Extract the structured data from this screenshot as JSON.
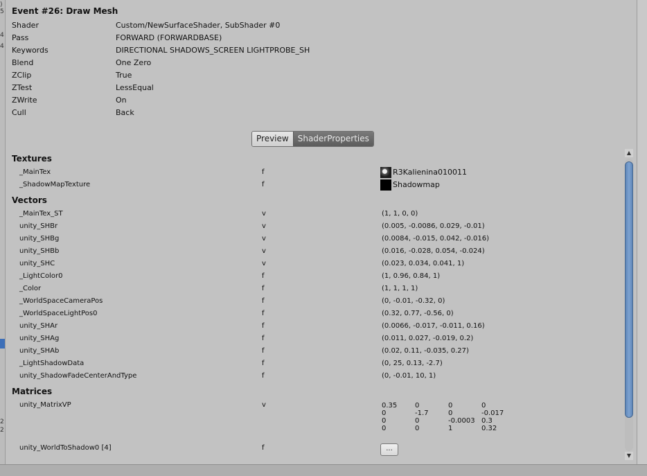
{
  "event": {
    "title": "Event #26: Draw Mesh",
    "properties": [
      {
        "key": "Shader",
        "value": "Custom/NewSurfaceShader, SubShader #0"
      },
      {
        "key": "Pass",
        "value": "FORWARD (FORWARDBASE)"
      },
      {
        "key": "Keywords",
        "value": "DIRECTIONAL SHADOWS_SCREEN LIGHTPROBE_SH"
      },
      {
        "key": "Blend",
        "value": "One Zero"
      },
      {
        "key": "ZClip",
        "value": "True"
      },
      {
        "key": "ZTest",
        "value": "LessEqual"
      },
      {
        "key": "ZWrite",
        "value": "On"
      },
      {
        "key": "Cull",
        "value": "Back"
      }
    ]
  },
  "tabs": [
    {
      "label": "Preview",
      "active": false
    },
    {
      "label": "ShaderProperties",
      "active": true
    }
  ],
  "textures": {
    "heading": "Textures",
    "items": [
      {
        "name": "_MainTex",
        "type": "f",
        "value": "R3Kalienina010011",
        "icon": "texture-thumbnail"
      },
      {
        "name": "_ShadowMapTexture",
        "type": "f",
        "value": "Shadowmap",
        "icon": "black-texture-thumbnail"
      }
    ]
  },
  "vectors": {
    "heading": "Vectors",
    "items": [
      {
        "name": "_MainTex_ST",
        "type": "v",
        "value": "(1, 1, 0, 0)"
      },
      {
        "name": "unity_SHBr",
        "type": "v",
        "value": "(0.005, -0.0086, 0.029, -0.01)"
      },
      {
        "name": "unity_SHBg",
        "type": "v",
        "value": "(0.0084, -0.015, 0.042, -0.016)"
      },
      {
        "name": "unity_SHBb",
        "type": "v",
        "value": "(0.016, -0.028, 0.054, -0.024)"
      },
      {
        "name": "unity_SHC",
        "type": "v",
        "value": "(0.023, 0.034, 0.041, 1)"
      },
      {
        "name": "_LightColor0",
        "type": "f",
        "value": "(1, 0.96, 0.84, 1)"
      },
      {
        "name": "_Color",
        "type": "f",
        "value": "(1, 1, 1, 1)"
      },
      {
        "name": "_WorldSpaceCameraPos",
        "type": "f",
        "value": "(0, -0.01, -0.32, 0)"
      },
      {
        "name": "_WorldSpaceLightPos0",
        "type": "f",
        "value": "(0.32, 0.77, -0.56, 0)"
      },
      {
        "name": "unity_SHAr",
        "type": "f",
        "value": "(0.0066, -0.017, -0.011, 0.16)"
      },
      {
        "name": "unity_SHAg",
        "type": "f",
        "value": "(0.011, 0.027, -0.019, 0.2)"
      },
      {
        "name": "unity_SHAb",
        "type": "f",
        "value": "(0.02, 0.11, -0.035, 0.27)"
      },
      {
        "name": "_LightShadowData",
        "type": "f",
        "value": "(0, 25, 0.13, -2.7)"
      },
      {
        "name": "unity_ShadowFadeCenterAndType",
        "type": "f",
        "value": "(0, -0.01, 10, 1)"
      }
    ]
  },
  "matrices": {
    "heading": "Matrices",
    "items": [
      {
        "name": "unity_MatrixVP",
        "type": "v",
        "rows": [
          [
            "0.35",
            "0",
            "0",
            "0"
          ],
          [
            "0",
            "-1.7",
            "0",
            "-0.017"
          ],
          [
            "0",
            "0",
            "-0.0003",
            "0.3"
          ],
          [
            "0",
            "0",
            "1",
            "0.32"
          ]
        ]
      },
      {
        "name": "unity_WorldToShadow0 [4]",
        "type": "f",
        "button": "..."
      }
    ]
  },
  "scrollbar": {
    "up_icon": "chevron-up-icon",
    "down_icon": "chevron-down-icon"
  }
}
